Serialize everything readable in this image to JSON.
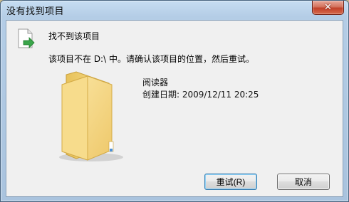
{
  "window": {
    "title": "没有找到项目",
    "close_label": "✕"
  },
  "dialog": {
    "heading": "找不到该项目",
    "message": "该项目不在 D:\\ 中。请确认该项目的位置，然后重试。",
    "item_name": "阅读器",
    "item_created": "创建日期: 2009/12/11 20:25"
  },
  "buttons": {
    "retry_label": "重试(R)",
    "cancel_label": "取消"
  },
  "icons": {
    "file_move": "file-move-icon",
    "folder": "folder-icon"
  },
  "colors": {
    "titlebar": "#b4cde6",
    "close_button": "#c2412a",
    "client_bg": "#f0f0f0",
    "folder": "#f4d67c"
  }
}
